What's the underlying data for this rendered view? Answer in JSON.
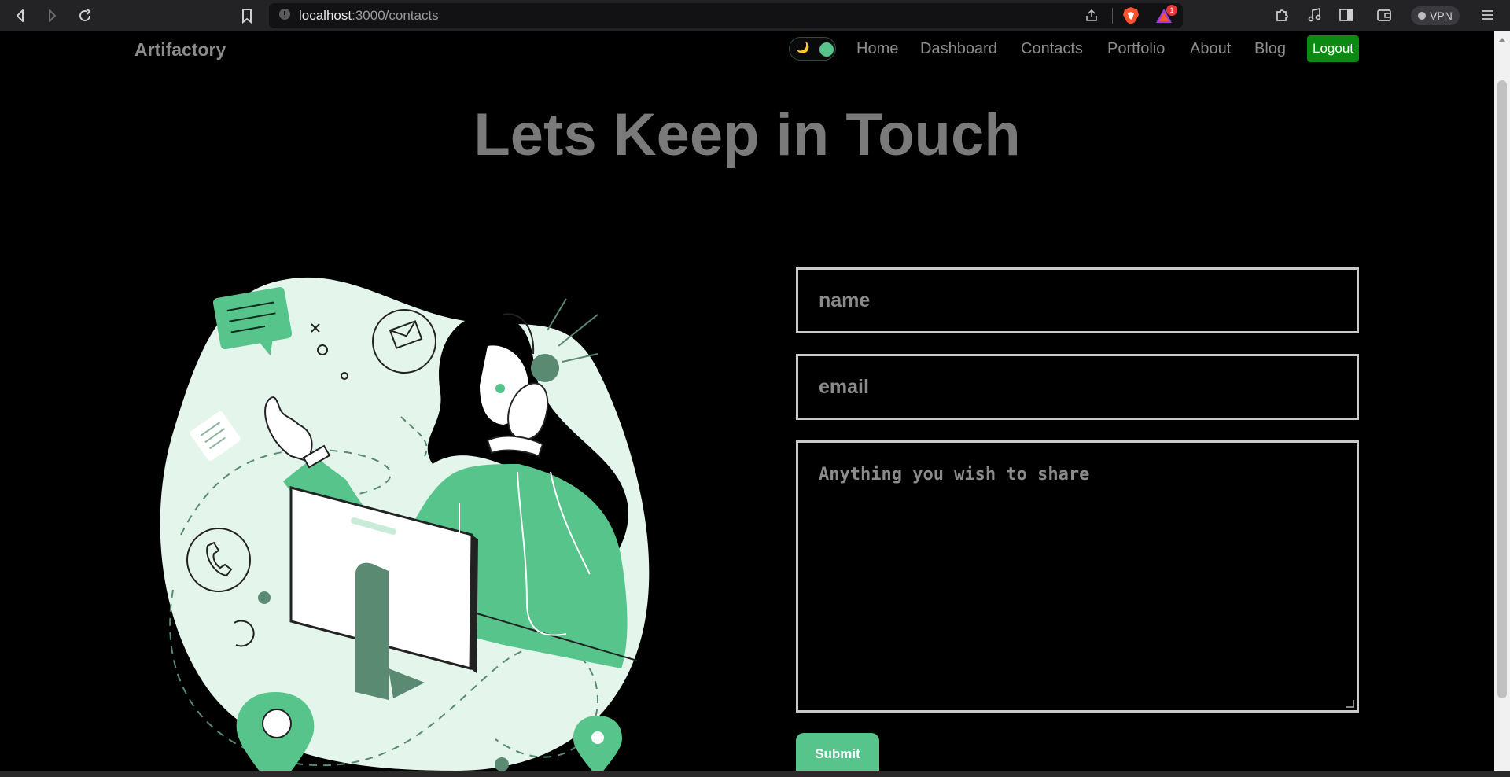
{
  "browser": {
    "url_host": "localhost",
    "url_path": ":3000/contacts",
    "vpn_label": "VPN",
    "badge_count": "1"
  },
  "navbar": {
    "brand": "Artifactory",
    "theme_icon": "moon-icon",
    "links": [
      "Home",
      "Dashboard",
      "Contacts",
      "Portfolio",
      "About",
      "Blog"
    ],
    "logout_label": "Logout"
  },
  "main": {
    "title": "Lets Keep in Touch"
  },
  "form": {
    "name_placeholder": "name",
    "email_placeholder": "email",
    "message_placeholder": "Anything you wish to share",
    "submit_label": "Submit"
  },
  "colors": {
    "accent_green": "#56c48b",
    "logout_green": "#0a8a12",
    "background": "#000000",
    "muted_text": "#8c8c8c"
  }
}
